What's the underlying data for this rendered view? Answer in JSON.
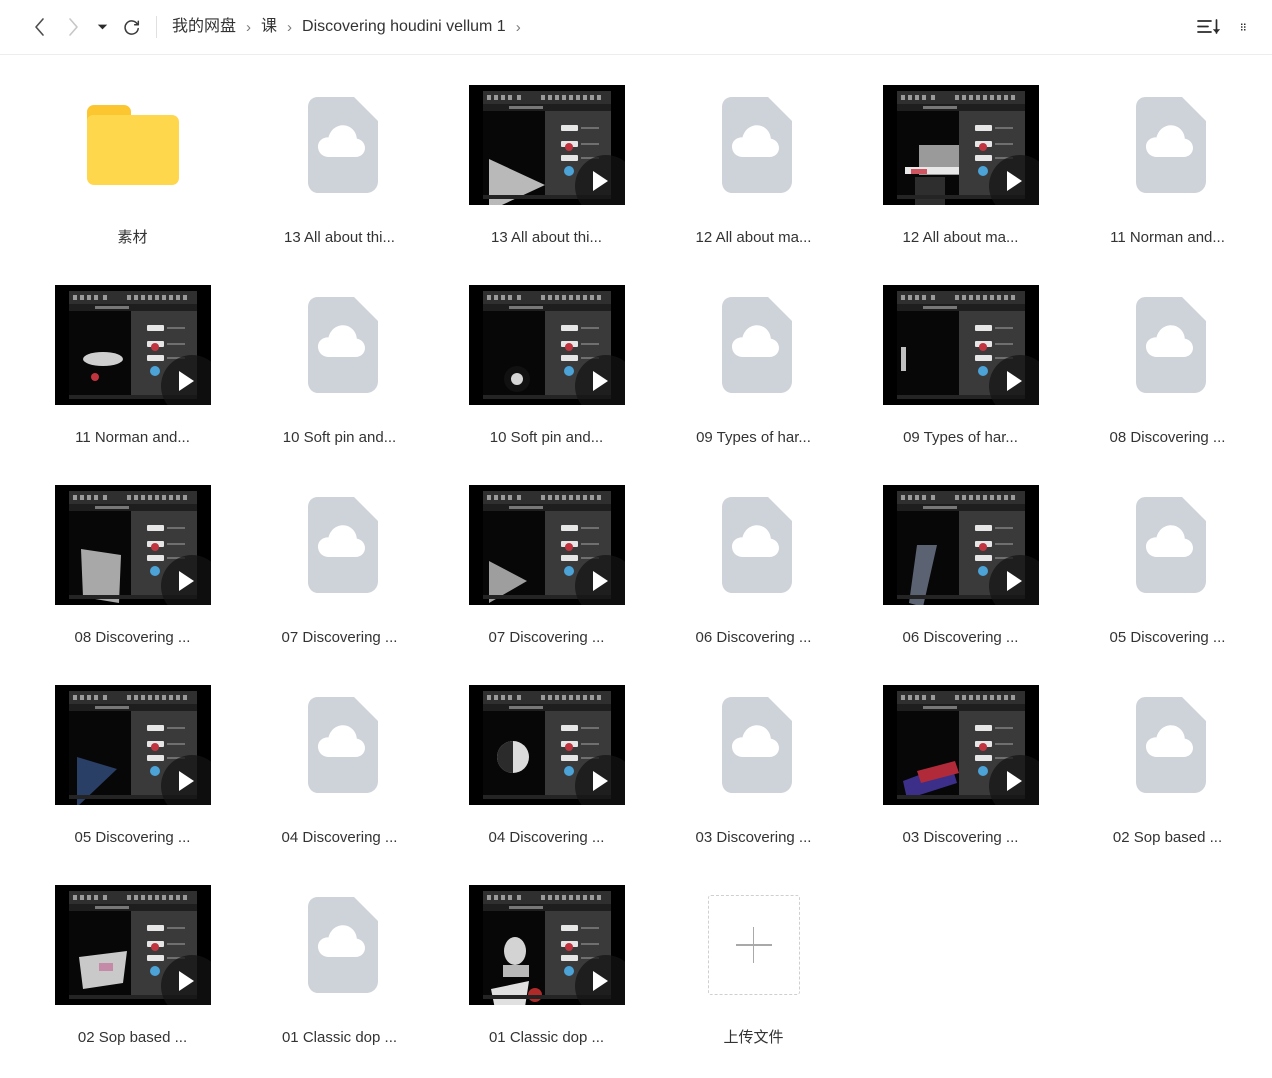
{
  "toolbar": {
    "nav": {
      "back_label": "‹",
      "forward_label": "›",
      "history_caret_label": "▾",
      "refresh_label": "refresh"
    },
    "breadcrumb": {
      "separator": "›",
      "items": [
        {
          "label": "我的网盘"
        },
        {
          "label": "课"
        },
        {
          "label": "Discovering houdini vellum 1"
        }
      ]
    },
    "actions": [
      {
        "name": "sort-icon",
        "label": "sort"
      },
      {
        "name": "grid-view-icon",
        "label": "view"
      }
    ]
  },
  "grid": {
    "items": [
      {
        "type": "folder",
        "label": "素材"
      },
      {
        "type": "doc",
        "label": "13 All about thi..."
      },
      {
        "type": "video",
        "label": "13 All about thi...",
        "scene": "a"
      },
      {
        "type": "doc",
        "label": "12 All about ma..."
      },
      {
        "type": "video",
        "label": "12 All about ma...",
        "scene": "b"
      },
      {
        "type": "doc",
        "label": "11 Norman and..."
      },
      {
        "type": "video",
        "label": "11 Norman and...",
        "scene": "c"
      },
      {
        "type": "doc",
        "label": "10 Soft pin and..."
      },
      {
        "type": "video",
        "label": "10 Soft pin and...",
        "scene": "d"
      },
      {
        "type": "doc",
        "label": "09 Types of har..."
      },
      {
        "type": "video",
        "label": "09 Types of har...",
        "scene": "e"
      },
      {
        "type": "doc",
        "label": "08 Discovering ..."
      },
      {
        "type": "video",
        "label": "08 Discovering ...",
        "scene": "f"
      },
      {
        "type": "doc",
        "label": "07 Discovering ..."
      },
      {
        "type": "video",
        "label": "07 Discovering ...",
        "scene": "g"
      },
      {
        "type": "doc",
        "label": "06 Discovering ..."
      },
      {
        "type": "video",
        "label": "06 Discovering ...",
        "scene": "h"
      },
      {
        "type": "doc",
        "label": "05 Discovering ..."
      },
      {
        "type": "video",
        "label": "05 Discovering ...",
        "scene": "i"
      },
      {
        "type": "doc",
        "label": "04 Discovering ..."
      },
      {
        "type": "video",
        "label": "04 Discovering ...",
        "scene": "j"
      },
      {
        "type": "doc",
        "label": "03 Discovering ..."
      },
      {
        "type": "video",
        "label": "03 Discovering ...",
        "scene": "k"
      },
      {
        "type": "doc",
        "label": "02 Sop based ..."
      },
      {
        "type": "video",
        "label": "02 Sop based ...",
        "scene": "l"
      },
      {
        "type": "doc",
        "label": "01 Classic dop ..."
      },
      {
        "type": "video",
        "label": "01 Classic dop ...",
        "scene": "m"
      },
      {
        "type": "upload",
        "label": "上传文件"
      },
      {
        "type": "empty",
        "label": ""
      },
      {
        "type": "empty",
        "label": ""
      }
    ]
  },
  "colors": {
    "folder": "#ffd74d",
    "folder_tab": "#fbc62f",
    "doc_placeholder": "#ced2d9",
    "text": "#333333",
    "thumb_bg": "#000000"
  }
}
